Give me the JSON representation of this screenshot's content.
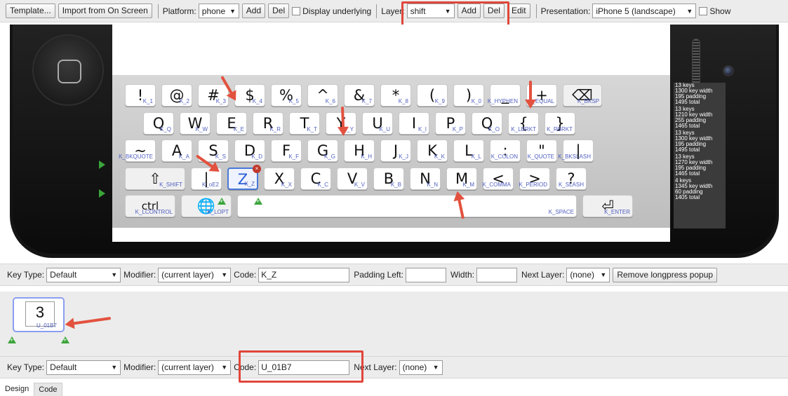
{
  "toolbar": {
    "template_label": "Template...",
    "import_label": "Import from On Screen",
    "platform_label": "Platform:",
    "platform_value": "phone",
    "add_label": "Add",
    "del_label": "Del",
    "display_underlying_label": "Display underlying",
    "layer_label": "Layer:",
    "layer_value": "shift",
    "layer_add_label": "Add",
    "layer_del_label": "Del",
    "edit_label": "Edit",
    "presentation_label": "Presentation:",
    "presentation_value": "iPhone 5 (landscape)",
    "show_label": "Show"
  },
  "keyboard": {
    "rows": [
      [
        {
          "cap": "!",
          "code": "K_1"
        },
        {
          "cap": "@",
          "code": "K_2"
        },
        {
          "cap": "#",
          "code": "K_3"
        },
        {
          "cap": "$",
          "code": "K_4"
        },
        {
          "cap": "%",
          "code": "K_5"
        },
        {
          "cap": "^",
          "code": "K_6"
        },
        {
          "cap": "&",
          "code": "K_7"
        },
        {
          "cap": "*",
          "code": "K_8"
        },
        {
          "cap": "(",
          "code": "K_9"
        },
        {
          "cap": ")",
          "code": "K_0"
        },
        {
          "cap": "_",
          "code": "K_HYPHEN"
        },
        {
          "cap": "+",
          "code": "K_EQUAL"
        },
        {
          "cap": "⌫",
          "code": "K_BKSP"
        }
      ],
      [
        {
          "cap": "Q",
          "code": "K_Q"
        },
        {
          "cap": "W",
          "code": "K_W"
        },
        {
          "cap": "E",
          "code": "K_E"
        },
        {
          "cap": "R",
          "code": "K_R"
        },
        {
          "cap": "T",
          "code": "K_T"
        },
        {
          "cap": "Y",
          "code": "K_Y"
        },
        {
          "cap": "U",
          "code": "K_U"
        },
        {
          "cap": "I",
          "code": "K_I"
        },
        {
          "cap": "P",
          "code": "K_P"
        },
        {
          "cap": "Q",
          "code": "K_O"
        },
        {
          "cap": "{",
          "code": "K_LBRKT"
        },
        {
          "cap": "}",
          "code": "K_RBRKT"
        }
      ],
      [
        {
          "cap": "~",
          "code": "K_BKQUOTE"
        },
        {
          "cap": "A",
          "code": "K_A"
        },
        {
          "cap": "S",
          "code": "K_S"
        },
        {
          "cap": "D",
          "code": "K_D"
        },
        {
          "cap": "F",
          "code": "K_F"
        },
        {
          "cap": "G",
          "code": "K_G"
        },
        {
          "cap": "H",
          "code": "K_H"
        },
        {
          "cap": "J",
          "code": "K_J"
        },
        {
          "cap": "K",
          "code": "K_K"
        },
        {
          "cap": "L",
          "code": "K_L"
        },
        {
          "cap": ":",
          "code": "K_COLON"
        },
        {
          "cap": "\"",
          "code": "K_QUOTE"
        },
        {
          "cap": "|",
          "code": "K_BKSLASH"
        }
      ],
      [
        {
          "cap": "⇧",
          "code": "K_SHIFT"
        },
        {
          "cap": "|",
          "code": "K_oE2"
        },
        {
          "cap": "Z",
          "code": "K_Z"
        },
        {
          "cap": "X",
          "code": "K_X"
        },
        {
          "cap": "C",
          "code": "K_C"
        },
        {
          "cap": "V",
          "code": "K_V"
        },
        {
          "cap": "B",
          "code": "K_B"
        },
        {
          "cap": "N",
          "code": "K_N"
        },
        {
          "cap": "M",
          "code": "K_M"
        },
        {
          "cap": "<",
          "code": "K_COMMA"
        },
        {
          "cap": ">",
          "code": "K_PERIOD"
        },
        {
          "cap": "?",
          "code": "K_SLASH"
        }
      ],
      [
        {
          "cap": "ctrl",
          "code": "K_LCONTROL"
        },
        {
          "cap": "🌐",
          "code": "K_LOPT"
        },
        {
          "cap": "",
          "code": "K_SPACE"
        },
        {
          "cap": "⏎",
          "code": "K_ENTER"
        }
      ]
    ],
    "stats": [
      [
        "13 keys",
        "1300 key width",
        "195 padding",
        "1495 total"
      ],
      [
        "13 keys",
        "1210 key width",
        "255 padding",
        "1465 total"
      ],
      [
        "13 keys",
        "1300 key width",
        "195 padding",
        "1495 total"
      ],
      [
        "13 keys",
        "1270 key width",
        "195 padding",
        "1465 total"
      ],
      [
        "4 keys",
        "1345 key width",
        "60 padding",
        "1405 total"
      ]
    ]
  },
  "key_props": {
    "key_type_label": "Key Type:",
    "key_type_value": "Default",
    "modifier_label": "Modifier:",
    "modifier_value": "(current layer)",
    "code_label": "Code:",
    "code_value": "K_Z",
    "padding_left_label": "Padding Left:",
    "padding_left_value": "",
    "width_label": "Width:",
    "width_value": "",
    "next_layer_label": "Next Layer:",
    "next_layer_value": "(none)",
    "remove_popup_label": "Remove longpress popup"
  },
  "popup": {
    "cap": "3",
    "code": "U_01B7"
  },
  "popup_props": {
    "key_type_label": "Key Type:",
    "key_type_value": "Default",
    "modifier_label": "Modifier:",
    "modifier_value": "(current layer)",
    "code_label": "Code:",
    "code_value": "U_01B7",
    "next_layer_label": "Next Layer:",
    "next_layer_value": "(none)"
  },
  "tabs": {
    "design": "Design",
    "code": "Code"
  }
}
